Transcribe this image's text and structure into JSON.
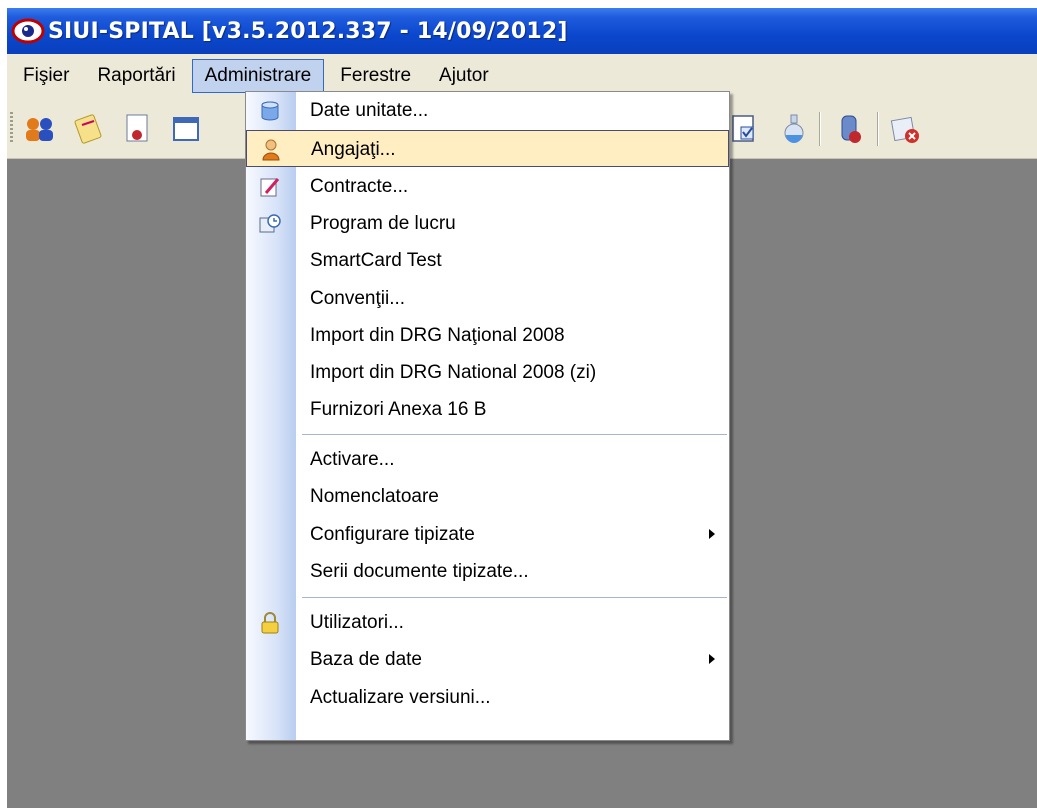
{
  "window": {
    "title": "SIUI-SPITAL [v3.5.2012.337 - 14/09/2012]"
  },
  "menubar": {
    "items": [
      {
        "label": "Fişier"
      },
      {
        "label": "Raportări"
      },
      {
        "label": "Administrare"
      },
      {
        "label": "Ferestre"
      },
      {
        "label": "Ajutor"
      }
    ]
  },
  "toolbar": {
    "buttons": [
      "users-icon",
      "notes-icon",
      "certificate-icon",
      "window-icon",
      "checklist-icon",
      "flask-icon",
      "medicine-icon",
      "exit-icon"
    ]
  },
  "dropdown": {
    "items": [
      {
        "label": "Date unitate...",
        "icon": "database-icon"
      },
      {
        "label": "Angajaţi...",
        "icon": "employee-icon"
      },
      {
        "label": "Contracte...",
        "icon": "contract-icon"
      },
      {
        "label": "Program de lucru",
        "icon": "schedule-icon"
      },
      {
        "label": "SmartCard Test"
      },
      {
        "label": "Convenţii..."
      },
      {
        "label": "Import din DRG Naţional 2008"
      },
      {
        "label": "Import din DRG National 2008 (zi)"
      },
      {
        "label": "Furnizori Anexa 16 B"
      },
      {
        "label": "Activare..."
      },
      {
        "label": "Nomenclatoare"
      },
      {
        "label": "Configurare tipizate"
      },
      {
        "label": "Serii documente tipizate..."
      },
      {
        "label": "Utilizatori...",
        "icon": "lock-icon"
      },
      {
        "label": "Baza de date"
      },
      {
        "label": "Actualizare versiuni..."
      }
    ]
  },
  "colors": {
    "titlebar": "#0b47cc",
    "workspace": "#808080",
    "menu_highlight": "#ffeec2"
  }
}
